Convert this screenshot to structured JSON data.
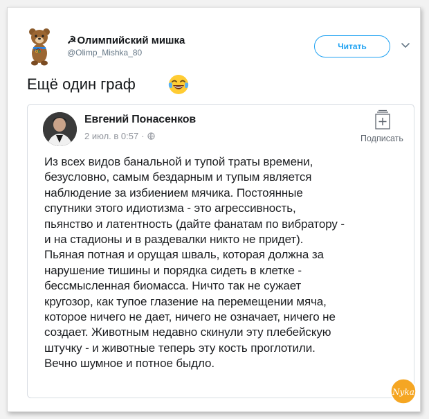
{
  "tweet": {
    "display_name_symbol": "☭",
    "display_name": "Олимпийский мишка",
    "username": "@Olimp_Mishka_80",
    "follow_label": "Читать",
    "text": "Ещё один граф",
    "emoji_icon": "face-with-tears-of-joy-icon"
  },
  "embedded_post": {
    "author": "Евгений Понасенков",
    "date": "2 июл. в 0:57",
    "separator": "·",
    "subscribe_label": "Подписать",
    "body_lines": [
      "Из всех видов банальной и тупой траты времени,",
      "безусловно, самым бездарным и тупым является",
      "наблюдение за избиением мячика. Постоянные",
      "спутники этого идиотизма - это агрессивность,",
      "пьянство и латентность (дайте фанатам по вибратору -",
      "и на стадионы и в раздевалки никто не придет).",
      "Пьяная потная и орущая шваль, которая должна за",
      "нарушение тишины и порядка сидеть в клетке -",
      "бессмысленная биомасса. Ничто так не сужает",
      "кругозор, как тупое глазение на перемещении мяча,",
      "которое ничего не дает, ничего не означает, ничего не",
      "создает. Животным недавно скинули эту плебейскую",
      "штучку - и животные теперь эту кость проглотили.",
      "Вечно шумное и потное быдло."
    ]
  },
  "watermark_text": "Nyka",
  "colors": {
    "accent": "#1da1f2",
    "watermark": "#f5a623"
  }
}
